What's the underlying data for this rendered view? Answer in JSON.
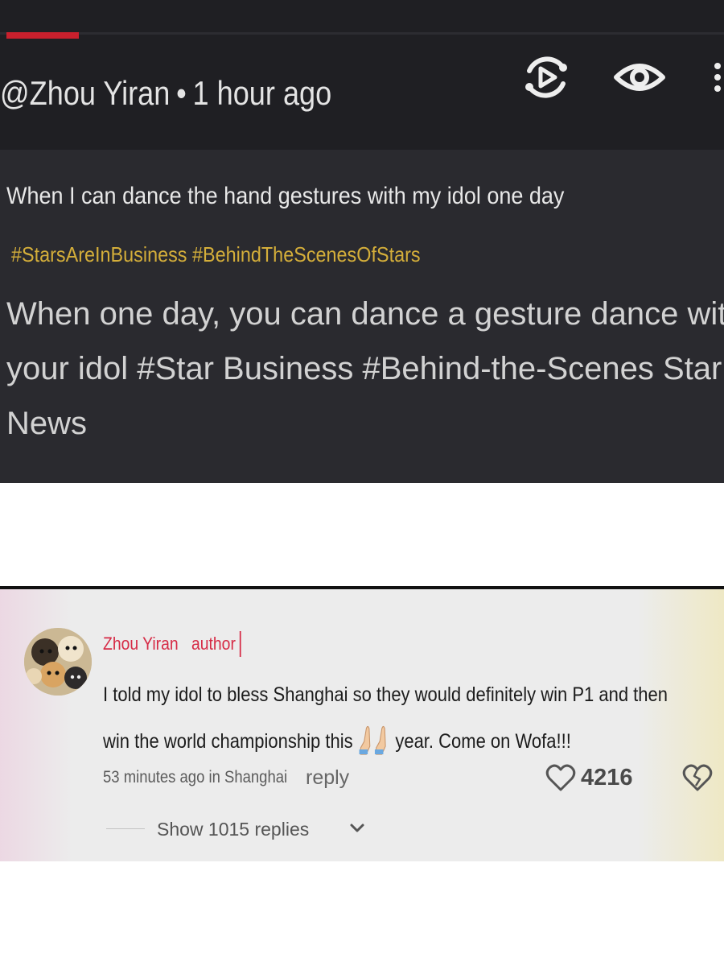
{
  "post": {
    "handle": "@Zhou Yiran",
    "separator": "•",
    "time_ago": "1 hour ago",
    "caption": "When I can dance the hand gestures with my idol one day",
    "hashtags": "#StarsAreInBusiness #BehindTheScenesOfStars",
    "translation": "When one day, you can dance a gesture dance with your idol #Star Business #Behind-the-Scenes Star News",
    "progress_fraction": 0.1,
    "icons": [
      "replay-icon",
      "eye-icon",
      "more-vertical-icon"
    ],
    "colors": {
      "background": "#2a2a2f",
      "header": "#1f1f23",
      "hashtag": "#d4ae3a",
      "progress": "#c8202d"
    }
  },
  "comment": {
    "author": "Zhou Yiran",
    "author_badge": "author",
    "text_before_emoji": "I told my idol to bless Shanghai so they would definitely win P1 and then win the world championship this",
    "text_after_emoji": "year.   Come on Wofa!!!",
    "emoji": "folded-hands-emoji",
    "timestamp": "53 minutes ago in Shanghai",
    "reply_label": "reply",
    "like_count": "4216",
    "show_replies": "Show 1015 replies",
    "icons": [
      "heart-icon",
      "broken-heart-icon",
      "chevron-down-icon"
    ],
    "colors": {
      "name": "#d62a45",
      "background": "#ececec"
    }
  }
}
